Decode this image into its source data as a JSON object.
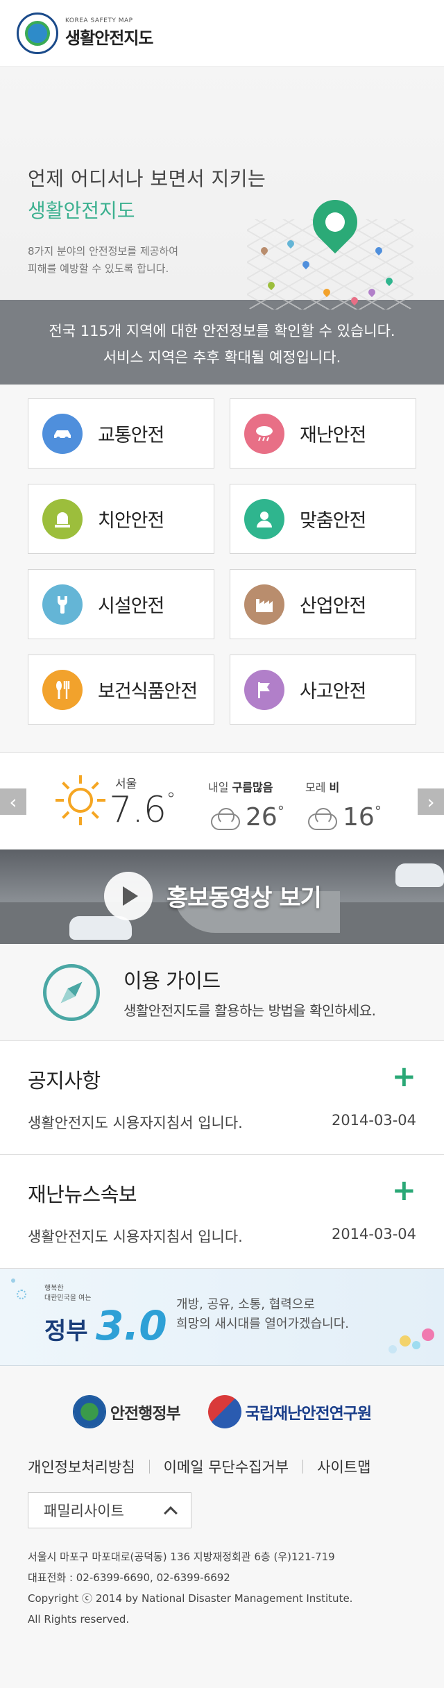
{
  "header": {
    "logo_small": "KOREA SAFETY MAP",
    "logo_title": "생활안전지도"
  },
  "hero": {
    "line1": "언제 어디서나 보면서 지키는",
    "line2": "생활안전지도",
    "desc": "8가지 분야의 안전정보를 제공하여\n피해를 예방할 수 있도록 합니다."
  },
  "banner": {
    "line1": "전국 115개 지역에 대한 안전정보를 확인할 수 있습니다.",
    "line2": "서비스 지역은 추후 확대될 예정입니다."
  },
  "categories": [
    {
      "label": "교통안전",
      "icon": "car-icon",
      "color": "#4f8fdc"
    },
    {
      "label": "재난안전",
      "icon": "rain-cloud-icon",
      "color": "#e86f86"
    },
    {
      "label": "치안안전",
      "icon": "siren-icon",
      "color": "#9cbe3c"
    },
    {
      "label": "맞춤안전",
      "icon": "person-icon",
      "color": "#2fb58e"
    },
    {
      "label": "시설안전",
      "icon": "wrench-icon",
      "color": "#64b5d6"
    },
    {
      "label": "산업안전",
      "icon": "factory-icon",
      "color": "#b98d6d"
    },
    {
      "label": "보건식품안전",
      "icon": "fork-knife-icon",
      "color": "#f2a22c"
    },
    {
      "label": "사고안전",
      "icon": "flag-icon",
      "color": "#b17fc9"
    }
  ],
  "weather": {
    "city": "서울",
    "temp": "7.6",
    "degree": "°",
    "tomorrow_label": "내일",
    "tomorrow_cond": "구름많음",
    "tomorrow_temp": "26",
    "dayafter_label": "모레",
    "dayafter_cond": "비",
    "dayafter_temp": "16",
    "prev": "‹",
    "next": "›"
  },
  "video": {
    "title": "홍보동영상 보기"
  },
  "guide": {
    "title": "이용 가이드",
    "desc": "생활안전지도를 활용하는 방법을 확인하세요."
  },
  "notices": [
    {
      "title": "공지사항",
      "item": "생활안전지도 시용자지침서 입니다.",
      "date": "2014-03-04",
      "plus": "+"
    },
    {
      "title": "재난뉴스속보",
      "item": "생활안전지도 시용자지침서 입니다.",
      "date": "2014-03-04",
      "plus": "+"
    }
  ],
  "gov": {
    "small": "행복한\n대한민국을 여는",
    "jeongbu": "정부",
    "three": "3.0",
    "msg": "개방, 공유, 소통, 협력으로\n희망의 새시대를 열어가겠습니다."
  },
  "footer": {
    "org1": "안전행정부",
    "org2": "국립재난안전연구원",
    "links": [
      "개인정보처리방침",
      "이메일 무단수집거부",
      "사이트맵"
    ],
    "family": "패밀리사이트",
    "address": "서울시 마포구 마포대로(공덕동) 136 지방재정회관 6층 (우)121-719",
    "phone": "대표전화 : 02-6399-6690, 02-6399-6692",
    "copyright": "Copyright ⓒ 2014 by National Disaster Management Institute.",
    "rights": "All Rights reserved."
  }
}
